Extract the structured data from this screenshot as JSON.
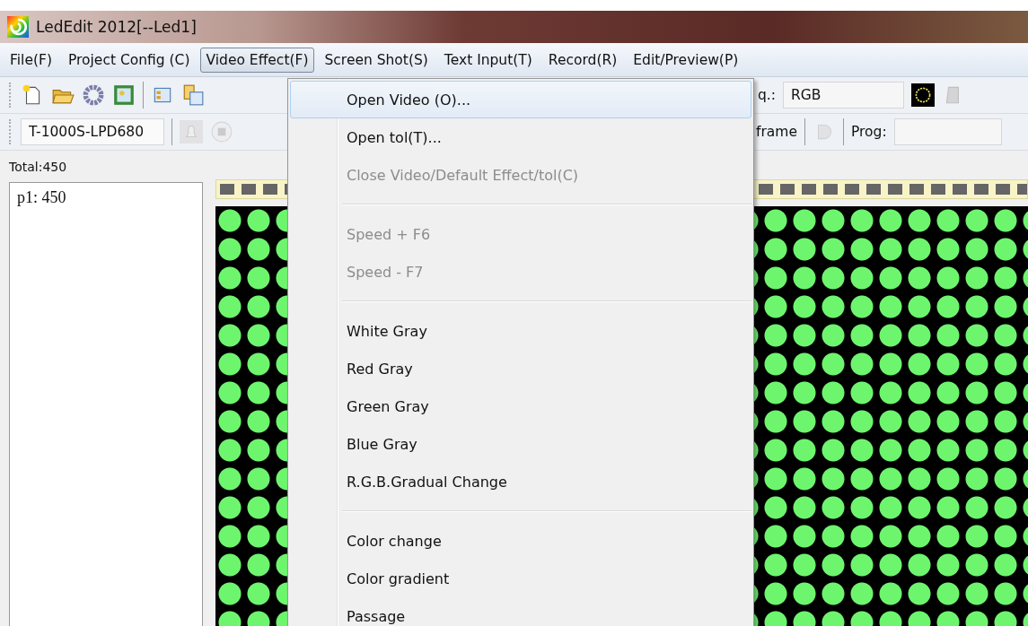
{
  "window": {
    "title": "LedEdit 2012[--Led1]"
  },
  "menu_bar": [
    {
      "label": "File(F)",
      "selected": false
    },
    {
      "label": "Project Config (C)",
      "selected": false
    },
    {
      "label": "Video Effect(F)",
      "selected": true
    },
    {
      "label": "Screen Shot(S)",
      "selected": false
    },
    {
      "label": "Text Input(T)",
      "selected": false
    },
    {
      "label": "Record(R)",
      "selected": false
    },
    {
      "label": "Edit/Preview(P)",
      "selected": false
    }
  ],
  "toolbar": {
    "color_order_label": "q.:",
    "color_order_value": "RGB"
  },
  "toolbar2": {
    "controller_value": "T-1000S-LPD680",
    "frame_label": "frame",
    "prog_label": "Prog:"
  },
  "total_label": "Total:450",
  "program_list": [
    "p1: 450"
  ],
  "dropdown": [
    {
      "kind": "item",
      "label": "Open Video (O)...",
      "disabled": false,
      "selected": true
    },
    {
      "kind": "item",
      "label": "Open tol(T)...",
      "disabled": false,
      "selected": false
    },
    {
      "kind": "item",
      "label": "Close Video/Default Effect/tol(C)",
      "disabled": true,
      "selected": false
    },
    {
      "kind": "separator"
    },
    {
      "kind": "item",
      "label": "Speed +  F6",
      "disabled": true,
      "selected": false
    },
    {
      "kind": "item",
      "label": "Speed -  F7",
      "disabled": true,
      "selected": false
    },
    {
      "kind": "separator"
    },
    {
      "kind": "item",
      "label": "White Gray",
      "disabled": false,
      "selected": false
    },
    {
      "kind": "item",
      "label": "Red Gray",
      "disabled": false,
      "selected": false
    },
    {
      "kind": "item",
      "label": "Green Gray",
      "disabled": false,
      "selected": false
    },
    {
      "kind": "item",
      "label": "Blue Gray",
      "disabled": false,
      "selected": false
    },
    {
      "kind": "item",
      "label": "R.G.B.Gradual Change",
      "disabled": false,
      "selected": false
    },
    {
      "kind": "separator"
    },
    {
      "kind": "item",
      "label": "Color change",
      "disabled": false,
      "selected": false
    },
    {
      "kind": "item",
      "label": "Color gradient",
      "disabled": false,
      "selected": false
    },
    {
      "kind": "item",
      "label": "Passage",
      "disabled": false,
      "selected": false
    }
  ]
}
